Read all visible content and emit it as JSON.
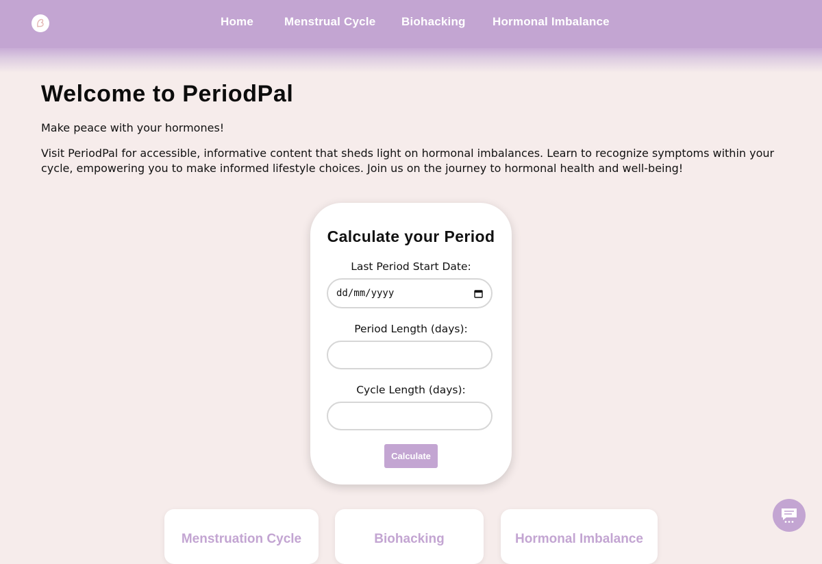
{
  "header": {
    "logo_icon": "period-pal-logo-icon",
    "nav": [
      {
        "label": "Home"
      },
      {
        "label": "Menstrual Cycle"
      },
      {
        "label": "Biohacking"
      },
      {
        "label": "Hormonal Imbalance"
      }
    ]
  },
  "hero": {
    "title": "Welcome to PeriodPal",
    "tagline": "Make peace with your hormones!",
    "intro": "Visit PeriodPal for accessible, informative content that sheds light on hormonal imbalances. Learn to recognize symptoms within your cycle, empowering you to make informed lifestyle choices. Join us on the journey to hormonal health and well-being!"
  },
  "calculator": {
    "title": "Calculate your Period",
    "last_period_label": "Last Period Start Date:",
    "last_period_placeholder": "dd/mm/yyyy",
    "period_length_label": "Period Length (days):",
    "period_length_value": "",
    "cycle_length_label": "Cycle Length (days):",
    "cycle_length_value": "",
    "submit_label": "Calculate",
    "calendar_icon": "calendar-icon"
  },
  "tiles": [
    {
      "title": "Menstruation Cycle"
    },
    {
      "title": "Biohacking"
    },
    {
      "title": "Hormonal Imbalance"
    }
  ],
  "chat": {
    "icon": "chat-bubble-icon"
  },
  "colors": {
    "accent": "#c3a5d2",
    "background": "#f6eceb",
    "card": "#ffffff"
  }
}
